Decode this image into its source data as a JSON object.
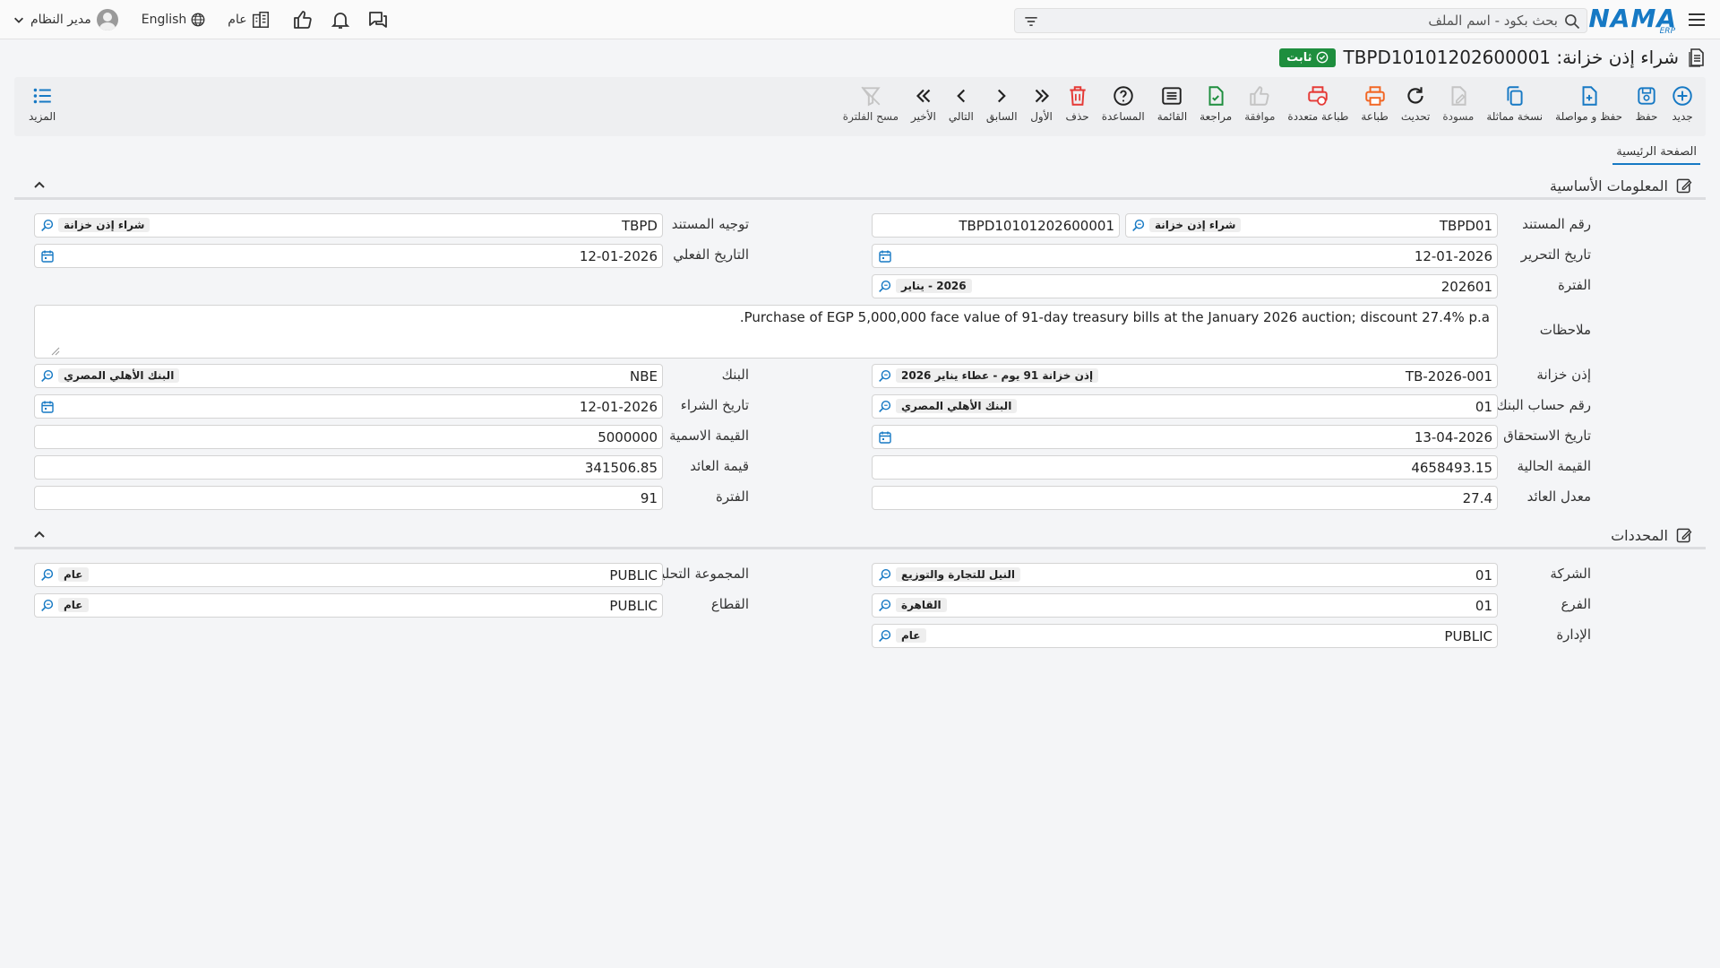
{
  "header": {
    "search_placeholder": "بحث بكود - اسم الملف",
    "logo_main": "NAMA",
    "logo_sub": "ERP",
    "user_name": "مدير النظام",
    "language": "English",
    "scope": "عام"
  },
  "title": {
    "text": "شراء إذن خزانة: TBPD10101202600001",
    "status": "ثابت"
  },
  "toolbar": {
    "new": "جديد",
    "save": "حفظ",
    "save_continue": "حفظ و مواصلة",
    "duplicate": "نسخة مماثلة",
    "draft": "مسودة",
    "refresh": "تحديث",
    "print": "طباعة",
    "multi_print": "طباعة متعددة",
    "approve": "موافقة",
    "review": "مراجعة",
    "list": "القائمة",
    "help": "المساعدة",
    "delete": "حذف",
    "first": "الأول",
    "previous": "السابق",
    "next": "التالي",
    "last": "الأخير",
    "clear_filter": "مسح الفلترة",
    "more": "المزيد"
  },
  "tabs": {
    "main": "الصفحة الرئيسية"
  },
  "basic": {
    "title": "المعلومات الأساسية",
    "doc_number_label": "رقم المستند",
    "doc_number_code": "TBPD01",
    "doc_number_name": "شراء إذن خزانة",
    "doc_number_full": "TBPD10101202600001",
    "doc_direction_label": "توجيه المستند",
    "doc_direction_code": "TBPD",
    "doc_direction_name": "شراء إذن خزانة",
    "edit_date_label": "تاريخ التحرير",
    "edit_date": "12-01-2026",
    "actual_date_label": "التاريخ الفعلي",
    "actual_date": "12-01-2026",
    "period_label": "الفترة",
    "period_code": "202601",
    "period_name": "2026 - يناير",
    "notes_label": "ملاحظات",
    "notes": "Purchase of EGP 5,000,000 face value of 91-day treasury bills at the January 2026 auction; discount 27.4% p.a.",
    "tbill_label": "إذن خزانة",
    "tbill_code": "TB-2026-001",
    "tbill_name": "إذن خزانة 91 يوم - عطاء يناير 2026",
    "bank_label": "البنك",
    "bank_code": "NBE",
    "bank_name": "البنك الأهلي المصري",
    "bank_account_label": "رقم حساب البنك",
    "bank_account_code": "01",
    "bank_account_name": "البنك الأهلي المصري",
    "purchase_date_label": "تاريخ الشراء",
    "purchase_date": "12-01-2026",
    "maturity_date_label": "تاريخ الاستحقاق",
    "maturity_date": "13-04-2026",
    "face_value_label": "القيمة الاسمية",
    "face_value": "5000000",
    "present_value_label": "القيمة الحالية",
    "present_value": "4658493.15",
    "yield_value_label": "قيمة العائد",
    "yield_value": "341506.85",
    "yield_rate_label": "معدل العائد",
    "yield_rate": "27.4",
    "days_label": "الفترة",
    "days": "91"
  },
  "dims": {
    "title": "المحددات",
    "company_label": "الشركة",
    "company_code": "01",
    "company_name": "النيل للتجارة والتوزيع",
    "analytic_label": "المجموعة التحليلية",
    "analytic_code": "PUBLIC",
    "analytic_name": "عام",
    "branch_label": "الفرع",
    "branch_code": "01",
    "branch_name": "القاهرة",
    "sector_label": "القطاع",
    "sector_code": "PUBLIC",
    "sector_name": "عام",
    "department_label": "الإدارة",
    "department_code": "PUBLIC",
    "department_name": "عام"
  },
  "colors": {
    "accent": "#1679c4",
    "success": "#1e8e3e",
    "danger": "#e53935",
    "print": "#f26522"
  }
}
